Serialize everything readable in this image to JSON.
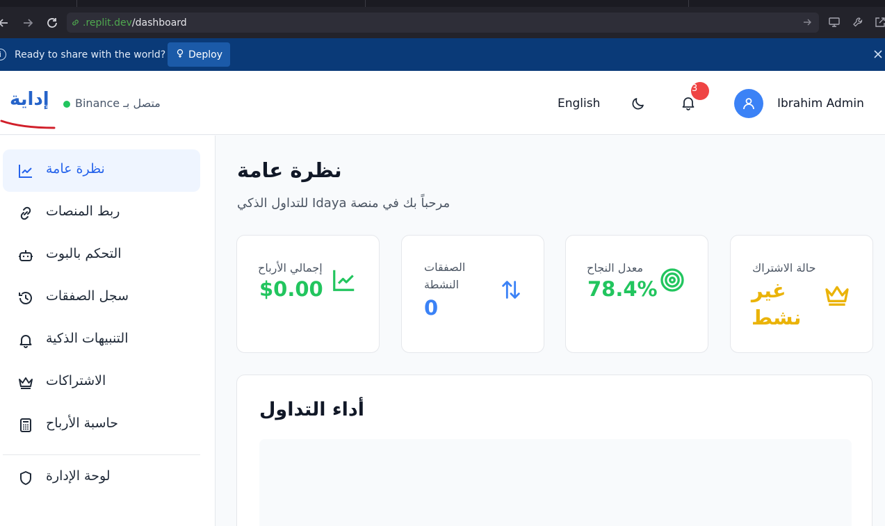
{
  "browser": {
    "url_host": ".replit.dev",
    "url_path": "/dashboard"
  },
  "banner": {
    "message": "Ready to share with the world?",
    "deploy_label": "Deploy"
  },
  "header": {
    "brand": "إداية",
    "exchange_status": "Binance متصل بـ",
    "language": "English",
    "notification_count": "3",
    "user_name": "Ibrahim Admin"
  },
  "sidebar": {
    "items": [
      {
        "label": "نظرة عامة",
        "icon": "chart-line-icon",
        "active": true
      },
      {
        "label": "ربط المنصات",
        "icon": "link-icon"
      },
      {
        "label": "التحكم بالبوت",
        "icon": "bot-icon"
      },
      {
        "label": "سجل الصفقات",
        "icon": "history-icon"
      },
      {
        "label": "التنبيهات الذكية",
        "icon": "bell-icon"
      },
      {
        "label": "الاشتراكات",
        "icon": "crown-icon"
      },
      {
        "label": "حاسبة الأرباح",
        "icon": "calculator-icon"
      },
      {
        "label": "لوحة الإدارة",
        "icon": "shield-icon"
      }
    ]
  },
  "main": {
    "title": "نظرة عامة",
    "subtitle": "للتداول الذكي Idaya مرحباً بك في منصة",
    "cards": [
      {
        "label": "إجمالي الأرباح",
        "value": "$0.00",
        "icon": "trending-chart-icon",
        "color": "#22c55e"
      },
      {
        "label_line1": "الصفقات",
        "label_line2": "النشطة",
        "value": "0",
        "icon": "arrows-up-down-icon",
        "color": "#3b82f6"
      },
      {
        "label": "معدل النجاح",
        "value": "78.4%",
        "icon": "target-icon",
        "color": "#22c55e"
      },
      {
        "label": "حالة الاشتراك",
        "value_line1": "غير",
        "value_line2": "نشط",
        "icon": "crown-icon",
        "color": "#eab308"
      }
    ],
    "performance_title": "أداء التداول"
  },
  "colors": {
    "accent": "#2563eb",
    "banner": "#0a3a78",
    "success": "#22c55e",
    "warning": "#eab308",
    "danger": "#ef4444"
  }
}
